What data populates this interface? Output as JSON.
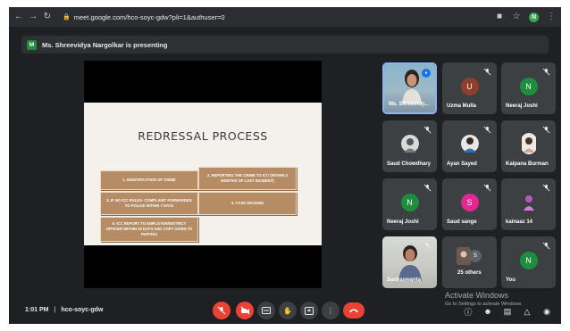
{
  "browser": {
    "url": "meet.google.com/hco-soyc-gdw?pli=1&authuser=0",
    "profile_initial": "N"
  },
  "banner": {
    "avatar_initial": "M",
    "text": "Ms. Shreevidya Nargolkar is presenting"
  },
  "slide": {
    "title": "REDRESSAL PROCESS",
    "steps": [
      "1.  IDENTIFICATION OF CRIME",
      "2.  REPORTING THE CRIME TO ICC (WITHIN 3 MONTHS OF LAST INCIDENT)",
      "3. IF NO ICC RULES- COMPLAINT FORWARDED TO POLICE WITHIN 7 DAYS",
      "4.  CASE DECIDED",
      "5. ICC REPORT TO EMPLOYER/DISTRICT OFFICER WITHIN 10 DAYS AND COPY GIVEN TO PARTIES"
    ]
  },
  "participants": [
    {
      "name": "Ms. Shreevidy...",
      "type": "video",
      "initial": ""
    },
    {
      "name": "Uzma Mulla",
      "type": "avatar",
      "initial": "U",
      "color": "#8d3f2b"
    },
    {
      "name": "Neeraj Joshi",
      "type": "avatar",
      "initial": "N",
      "color": "#1e8e3e"
    },
    {
      "name": "Saud Chowdhary",
      "type": "photo",
      "initial": ""
    },
    {
      "name": "Ayan Sayed",
      "type": "photo",
      "initial": ""
    },
    {
      "name": "Kalpana Burman",
      "type": "photo",
      "initial": ""
    },
    {
      "name": "Neeraj Joshi",
      "type": "avatar",
      "initial": "N",
      "color": "#1e8e3e"
    },
    {
      "name": "Saud sange",
      "type": "avatar",
      "initial": "S",
      "color": "#e52592"
    },
    {
      "name": "kainaaz 14",
      "type": "photo",
      "initial": ""
    },
    {
      "name": "Sachaswanta",
      "type": "video",
      "initial": ""
    },
    {
      "name": "25 others",
      "type": "others",
      "initial": "S"
    },
    {
      "name": "You",
      "type": "avatar",
      "initial": "N",
      "color": "#1e8e3e"
    }
  ],
  "bottom": {
    "time": "1:01 PM",
    "separator": "|",
    "meeting_code": "hco-soyc-gdw"
  },
  "watermark": {
    "line1": "Activate Windows",
    "line2": "Go to Settings to activate Windows."
  }
}
